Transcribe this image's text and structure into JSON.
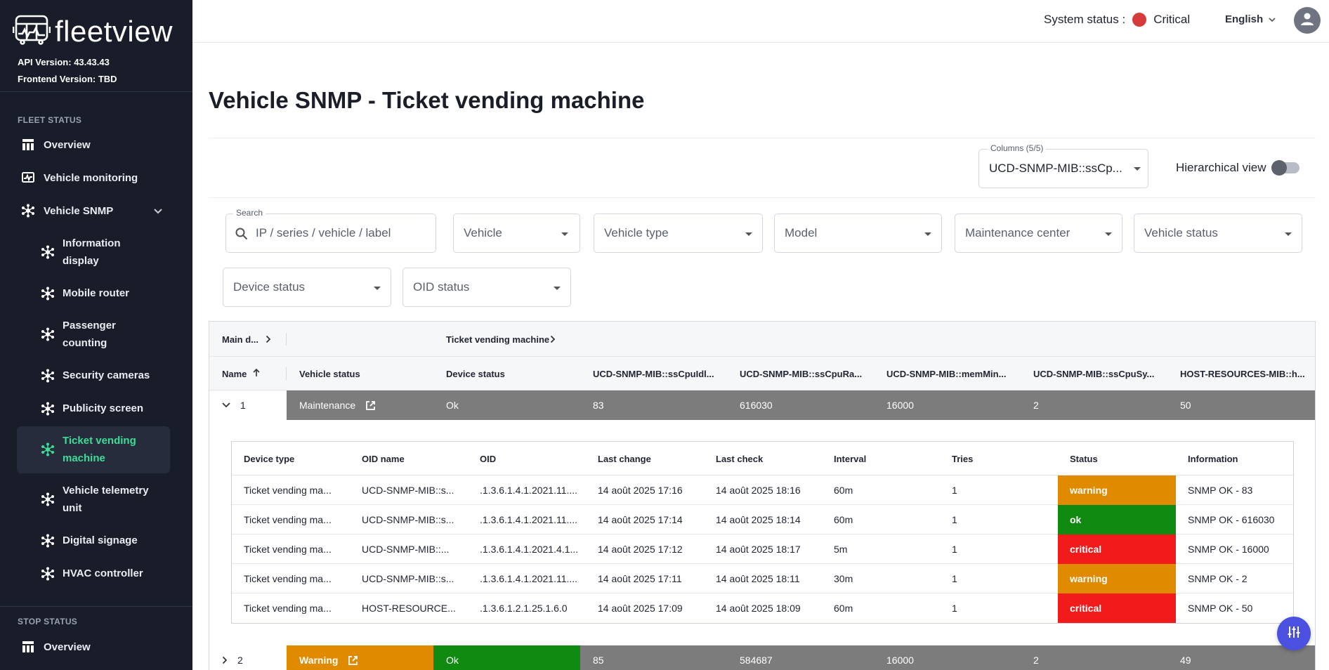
{
  "app": {
    "name": "fleetview",
    "api_version": "API Version: 43.43.43",
    "frontend_version": "Frontend Version: TBD"
  },
  "sidebar": {
    "fleet_section": "FLEET STATUS",
    "stop_section": "STOP STATUS",
    "items": [
      {
        "label": "Overview",
        "icon": "grid-icon"
      },
      {
        "label": "Vehicle monitoring",
        "icon": "monitor-pulse-icon"
      },
      {
        "label": "Vehicle SNMP",
        "icon": "network-nodes-icon"
      }
    ],
    "snmp_children": [
      {
        "label": "Information display"
      },
      {
        "label": "Mobile router"
      },
      {
        "label": "Passenger counting"
      },
      {
        "label": "Security cameras"
      },
      {
        "label": "Publicity screen"
      },
      {
        "label": "Ticket vending machine",
        "active": true
      },
      {
        "label": "Vehicle telemetry unit"
      },
      {
        "label": "Digital signage"
      },
      {
        "label": "HVAC controller"
      }
    ],
    "stop_items": [
      {
        "label": "Overview"
      }
    ]
  },
  "header": {
    "system_status_label": "System status :",
    "system_status_value": "Critical",
    "system_status_color": "#d63b3b",
    "language": "English"
  },
  "page": {
    "title": "Vehicle SNMP - Ticket vending machine"
  },
  "toolbar": {
    "columns_label": "Columns (5/5)",
    "columns_value": "UCD-SNMP-MIB::ssCp...",
    "hierarchical_view": "Hierarchical view",
    "hierarchical_on": false
  },
  "filters": {
    "search_label": "Search",
    "search_placeholder": "IP / series / vehicle / label",
    "vehicle": "Vehicle",
    "vehicle_type": "Vehicle type",
    "model": "Model",
    "maintenance_center": "Maintenance center",
    "vehicle_status": "Vehicle status",
    "device_status": "Device status",
    "oid_status": "OID status"
  },
  "table": {
    "groups": {
      "main": "Main d...",
      "tvm": "Ticket vending machine"
    },
    "columns": [
      "Name",
      "Vehicle status",
      "Device status",
      "UCD-SNMP-MIB::ssCpuIdl...",
      "UCD-SNMP-MIB::ssCpuRa...",
      "UCD-SNMP-MIB::memMin...",
      "UCD-SNMP-MIB::ssCpuSy...",
      "HOST-RESOURCES-MIB::h..."
    ],
    "rows": [
      {
        "name": "1",
        "vehicle_status": "Maintenance",
        "device_status": "Ok",
        "v1": "83",
        "v2": "616030",
        "v3": "16000",
        "v4": "2",
        "v5": "50"
      },
      {
        "name": "2",
        "vehicle_status": "Warning",
        "device_status": "Ok",
        "v1": "85",
        "v2": "584687",
        "v3": "16000",
        "v4": "2",
        "v5": "49"
      }
    ],
    "colors": {
      "maintenance": "#7c7c7c",
      "warning": "#e08a00",
      "ok": "#118a11",
      "critical": "#f21b1b"
    }
  },
  "subtable": {
    "columns": [
      "Device type",
      "OID name",
      "OID",
      "Last change",
      "Last check",
      "Interval",
      "Tries",
      "Status",
      "Information"
    ],
    "rows": [
      {
        "device_type": "Ticket vending ma...",
        "oid_name": "UCD-SNMP-MIB::s...",
        "oid": ".1.3.6.1.4.1.2021.11....",
        "last_change": "14 août 2025 17:16",
        "last_check": "14 août 2025 18:16",
        "interval": "60m",
        "tries": "1",
        "status": "warning",
        "information": "SNMP OK - 83"
      },
      {
        "device_type": "Ticket vending ma...",
        "oid_name": "UCD-SNMP-MIB::s...",
        "oid": ".1.3.6.1.4.1.2021.11....",
        "last_change": "14 août 2025 17:14",
        "last_check": "14 août 2025 18:14",
        "interval": "60m",
        "tries": "1",
        "status": "ok",
        "information": "SNMP OK - 616030"
      },
      {
        "device_type": "Ticket vending ma...",
        "oid_name": "UCD-SNMP-MIB::...",
        "oid": ".1.3.6.1.4.1.2021.4.1...",
        "last_change": "14 août 2025 17:12",
        "last_check": "14 août 2025 18:17",
        "interval": "5m",
        "tries": "1",
        "status": "critical",
        "information": "SNMP OK - 16000"
      },
      {
        "device_type": "Ticket vending ma...",
        "oid_name": "UCD-SNMP-MIB::s...",
        "oid": ".1.3.6.1.4.1.2021.11....",
        "last_change": "14 août 2025 17:11",
        "last_check": "14 août 2025 18:11",
        "interval": "30m",
        "tries": "1",
        "status": "warning",
        "information": "SNMP OK - 2"
      },
      {
        "device_type": "Ticket vending ma...",
        "oid_name": "HOST-RESOURCE...",
        "oid": ".1.3.6.1.2.1.25.1.6.0",
        "last_change": "14 août 2025 17:09",
        "last_check": "14 août 2025 18:09",
        "interval": "60m",
        "tries": "1",
        "status": "critical",
        "information": "SNMP OK - 50"
      }
    ]
  }
}
